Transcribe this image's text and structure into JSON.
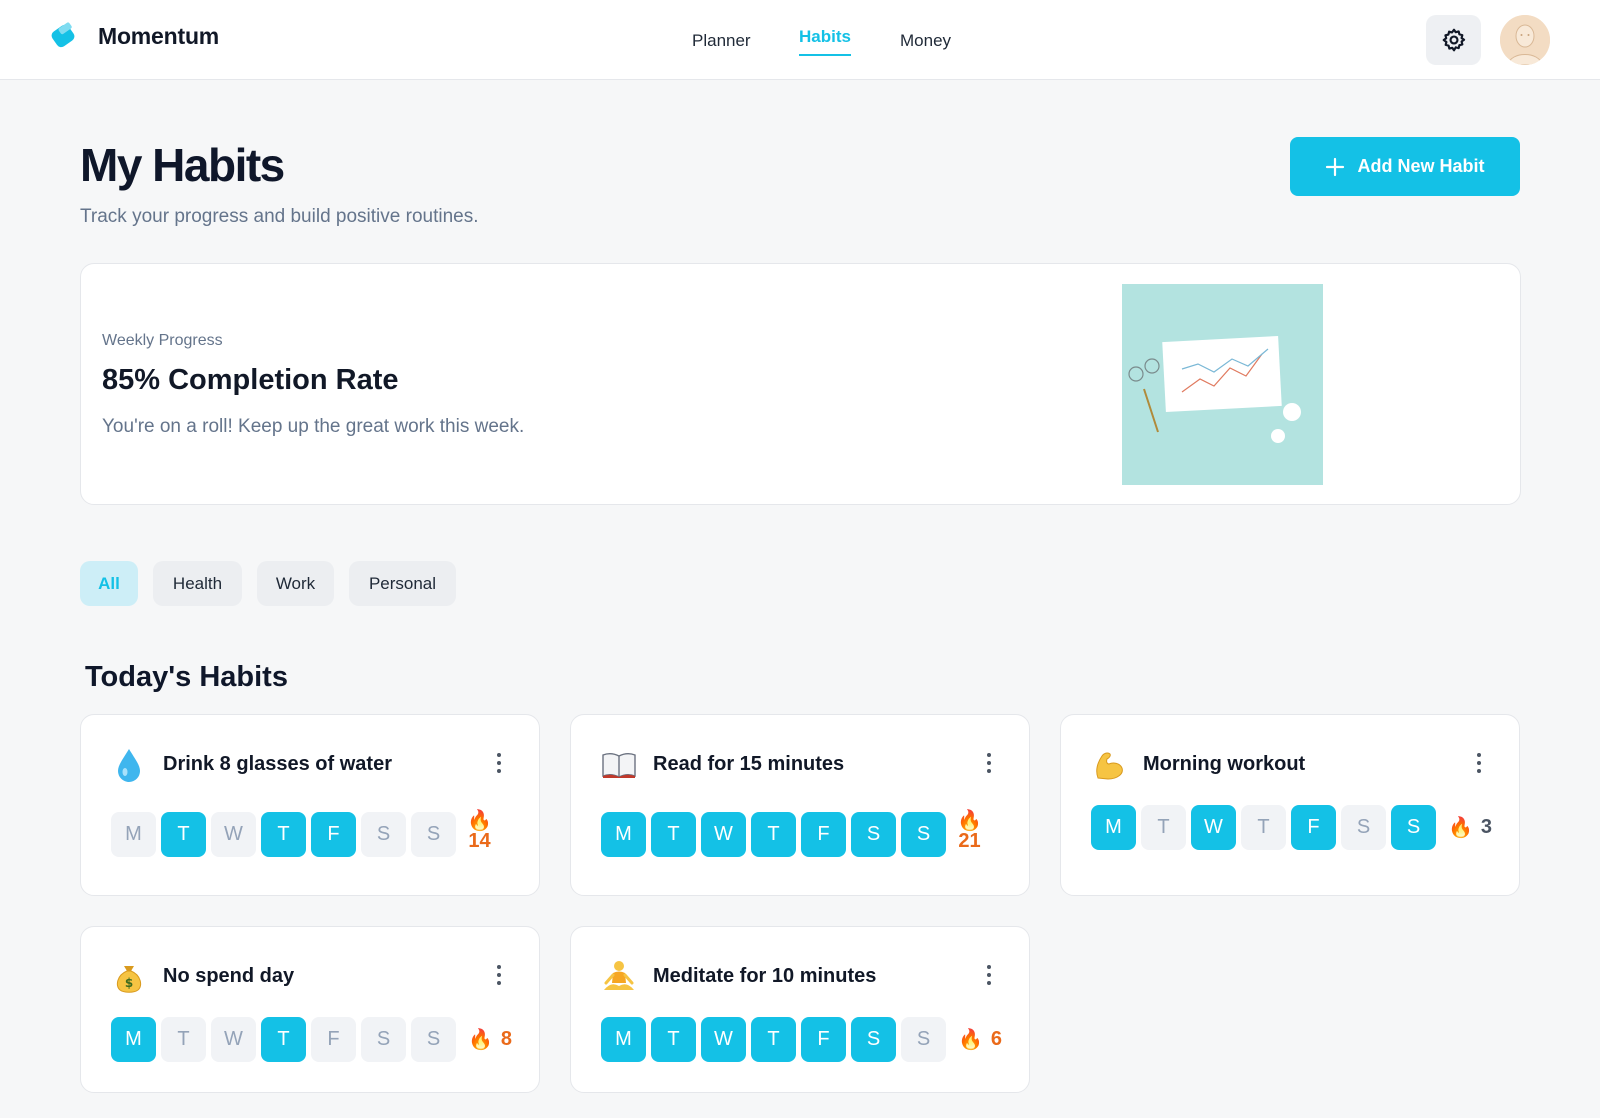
{
  "app": {
    "name": "Momentum"
  },
  "nav": {
    "items": [
      {
        "label": "Planner"
      },
      {
        "label": "Habits"
      },
      {
        "label": "Money"
      }
    ],
    "active": "Habits"
  },
  "header": {
    "title": "My Habits",
    "subtitle": "Track your progress and build positive routines.",
    "add_label": "Add New Habit"
  },
  "progress": {
    "label": "Weekly Progress",
    "title": "85% Completion Rate",
    "description": "You're on a roll! Keep up the great work this week."
  },
  "filters": [
    {
      "label": "All",
      "active": true
    },
    {
      "label": "Health"
    },
    {
      "label": "Work"
    },
    {
      "label": "Personal"
    }
  ],
  "section": {
    "title": "Today's Habits"
  },
  "habits": [
    {
      "name": "Drink 8 glasses of water",
      "icon": "water-drop-icon",
      "days": [
        [
          "M",
          false
        ],
        [
          "T",
          true
        ],
        [
          "W",
          false
        ],
        [
          "T",
          true
        ],
        [
          "F",
          true
        ],
        [
          "S",
          false
        ],
        [
          "S",
          false
        ]
      ],
      "streak": "14"
    },
    {
      "name": "Read for 15 minutes",
      "icon": "open-book-icon",
      "days": [
        [
          "M",
          true
        ],
        [
          "T",
          true
        ],
        [
          "W",
          true
        ],
        [
          "T",
          true
        ],
        [
          "F",
          true
        ],
        [
          "S",
          true
        ],
        [
          "S",
          true
        ]
      ],
      "streak": "21"
    },
    {
      "name": "Morning workout",
      "icon": "flexed-bicep-icon",
      "days": [
        [
          "M",
          true
        ],
        [
          "T",
          false
        ],
        [
          "W",
          true
        ],
        [
          "T",
          false
        ],
        [
          "F",
          true
        ],
        [
          "S",
          false
        ],
        [
          "S",
          true
        ]
      ],
      "streak": "3"
    },
    {
      "name": "No spend day",
      "icon": "money-bag-icon",
      "days": [
        [
          "M",
          true
        ],
        [
          "T",
          false
        ],
        [
          "W",
          false
        ],
        [
          "T",
          true
        ],
        [
          "F",
          false
        ],
        [
          "S",
          false
        ],
        [
          "S",
          false
        ]
      ],
      "streak": "8"
    },
    {
      "name": "Meditate for 10 minutes",
      "icon": "meditation-icon",
      "days": [
        [
          "M",
          true
        ],
        [
          "T",
          true
        ],
        [
          "W",
          true
        ],
        [
          "T",
          true
        ],
        [
          "F",
          true
        ],
        [
          "S",
          true
        ],
        [
          "S",
          false
        ]
      ],
      "streak": "6"
    }
  ],
  "colors": {
    "accent": "#14c1e6",
    "streak": "#ea6a1a",
    "background": "#f6f7f8"
  }
}
